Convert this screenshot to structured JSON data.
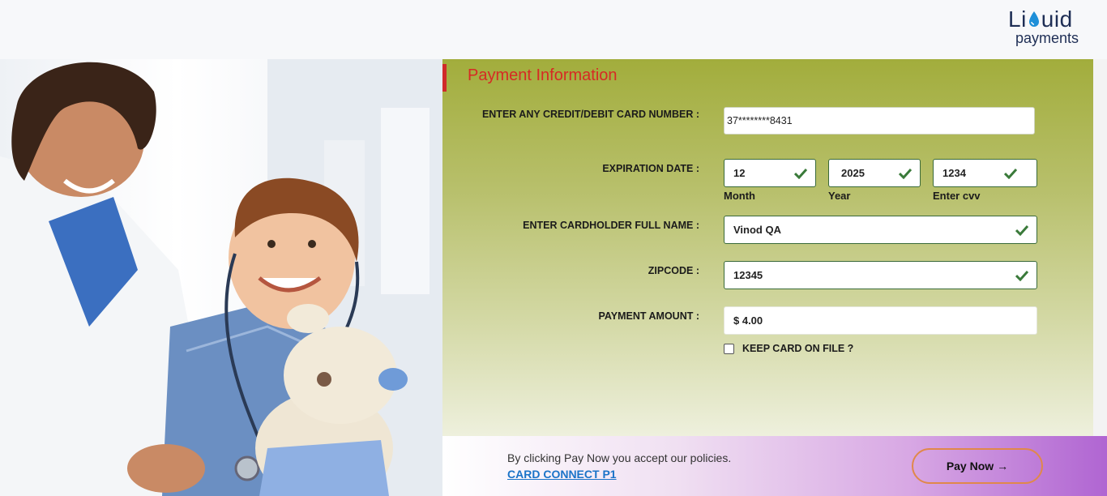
{
  "logo": {
    "top_text_left": "Li",
    "top_text_right": "uid",
    "bottom_text": "payments"
  },
  "form": {
    "section_title": "Payment Information",
    "card_number": {
      "label": "ENTER ANY CREDIT/DEBIT CARD NUMBER :",
      "value": "37********8431"
    },
    "expiration": {
      "label": "EXPIRATION DATE :",
      "month": {
        "value": "12",
        "caption": "Month"
      },
      "year": {
        "value": "2025",
        "caption": "Year"
      },
      "cvv": {
        "value": "1234",
        "caption": "Enter cvv"
      }
    },
    "cardholder": {
      "label": "ENTER CARDHOLDER FULL NAME :",
      "value": "Vinod QA"
    },
    "zipcode": {
      "label": "ZIPCODE :",
      "value": "12345"
    },
    "amount": {
      "label": "PAYMENT AMOUNT :",
      "value": "$ 4.00"
    },
    "keep_card": {
      "label": "KEEP CARD ON FILE ?",
      "checked": false
    }
  },
  "footer": {
    "policy_text": "By clicking Pay Now you accept our policies.",
    "policy_link": "CARD CONNECT P1",
    "pay_button": "Pay Now",
    "pay_arrow": "→"
  },
  "colors": {
    "title_red": "#d62a24",
    "valid_green": "#3a7a3a",
    "link_blue": "#1a73c8",
    "button_border": "#e0884a"
  }
}
